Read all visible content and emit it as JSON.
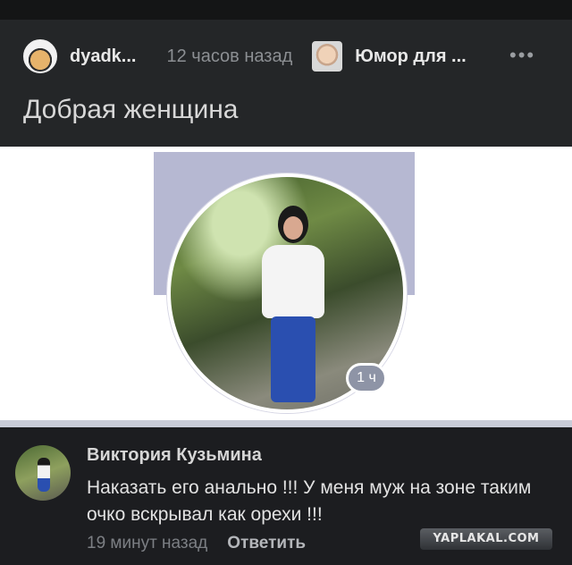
{
  "post": {
    "author": "dyadk...",
    "time": "12 часов назад",
    "community": "Юмор для ...",
    "more_icon": "ellipsis-icon",
    "more_label": "•••",
    "title": "Добрая женщина"
  },
  "story": {
    "badge": "1 ч"
  },
  "comment": {
    "name": "Виктория Кузьмина",
    "text": "Наказать его анально !!! У меня муж на зоне таким очко вскрывал как орехи !!!",
    "time": "19 минут назад",
    "reply_label": "Ответить"
  },
  "watermark": "YAPLAKAL.COM"
}
